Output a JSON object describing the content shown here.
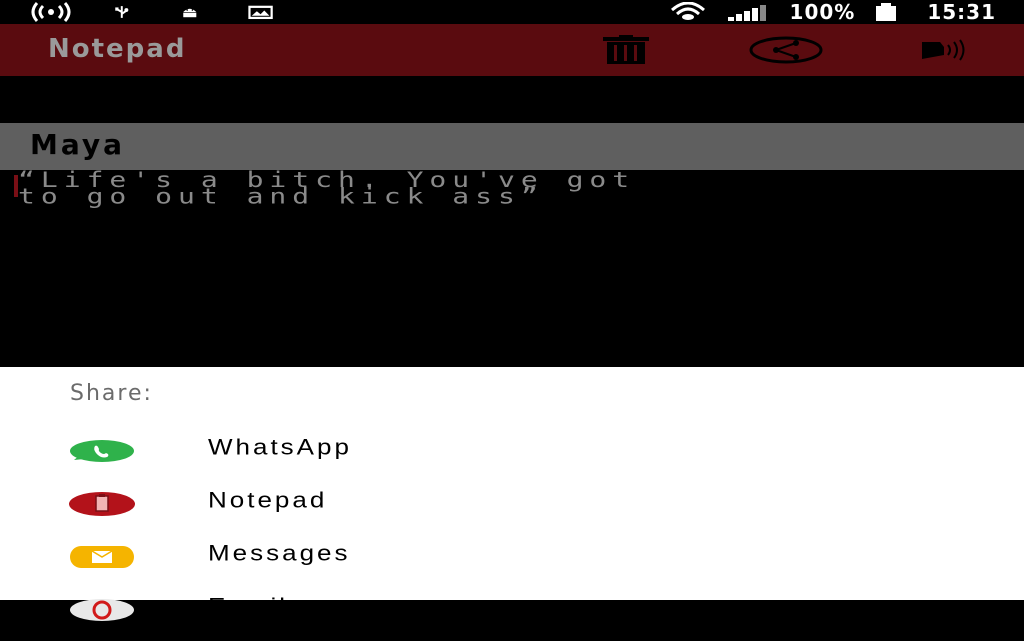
{
  "status_bar": {
    "battery": "100%",
    "time": "15:31",
    "icons": [
      "hotspot-icon",
      "usb-icon",
      "android-icon",
      "image-icon",
      "wifi-icon",
      "signal-icon",
      "battery-icon"
    ]
  },
  "app_bar": {
    "title": "Notepad",
    "actions": [
      "delete-icon",
      "share-icon",
      "speak-icon"
    ],
    "accent": "#5a0b0f"
  },
  "note": {
    "title": "Maya",
    "line1": "“Life's a bitch. You've got",
    "line2": "to go out and kick ass”"
  },
  "share_sheet": {
    "label": "Share:",
    "items": [
      {
        "label": "WhatsApp",
        "icon": "whatsapp-icon"
      },
      {
        "label": "Notepad",
        "icon": "notepad-icon"
      },
      {
        "label": "Messages",
        "icon": "messages-icon"
      },
      {
        "label": "Email",
        "icon": "email-icon"
      }
    ]
  }
}
